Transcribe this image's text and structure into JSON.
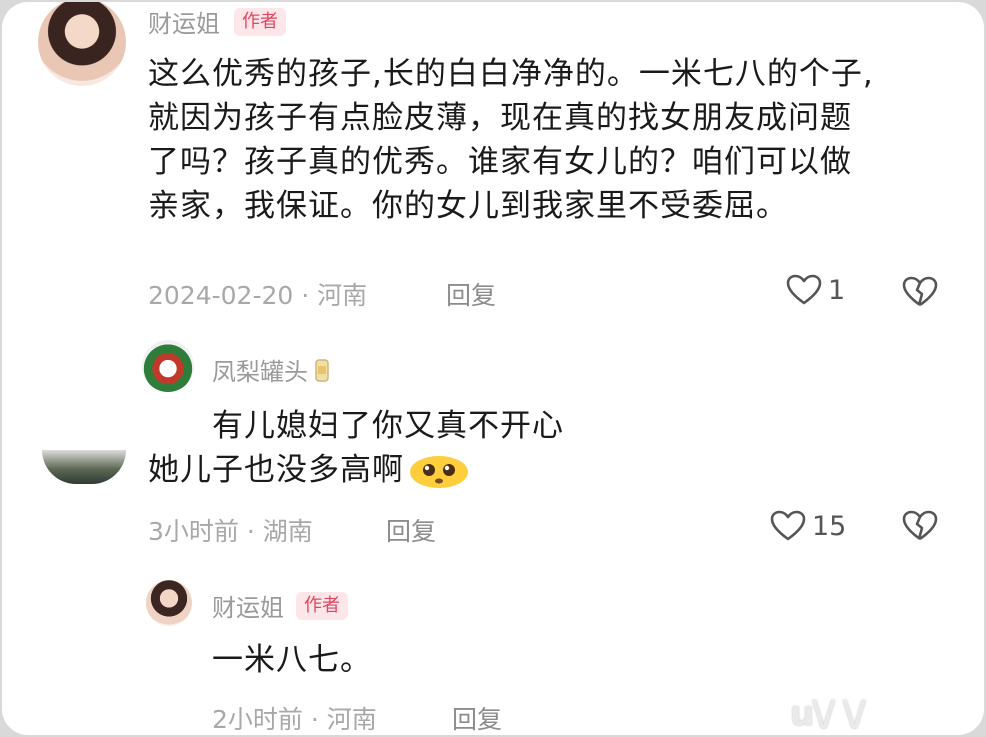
{
  "comment": {
    "username": "财运姐",
    "badge": "作者",
    "lines": [
      "这么优秀的孩子,长的白白净净的。一米七八的个子,",
      "就因为孩子有点脸皮薄，现在真的找女朋友成问题",
      "了吗？孩子真的优秀。谁家有女儿的？咱们可以做",
      "亲家，我保证。你的女儿到我家里不受委屈。"
    ],
    "date": "2024-02-20",
    "location": "河南",
    "reply_label": "回复",
    "like_count": "1"
  },
  "reply1": {
    "username": "凤梨罐头",
    "line1": "有儿媳妇了你又真不开心",
    "line2": "她儿子也没多高啊",
    "time": "3小时前",
    "location": "湖南",
    "reply_label": "回复",
    "like_count": "15"
  },
  "reply2": {
    "username": "财运姐",
    "badge": "作者",
    "text": "一米八七。",
    "time": "2小时前",
    "location": "河南",
    "reply_label": "回复"
  },
  "watermark": "u\\/ \\/"
}
